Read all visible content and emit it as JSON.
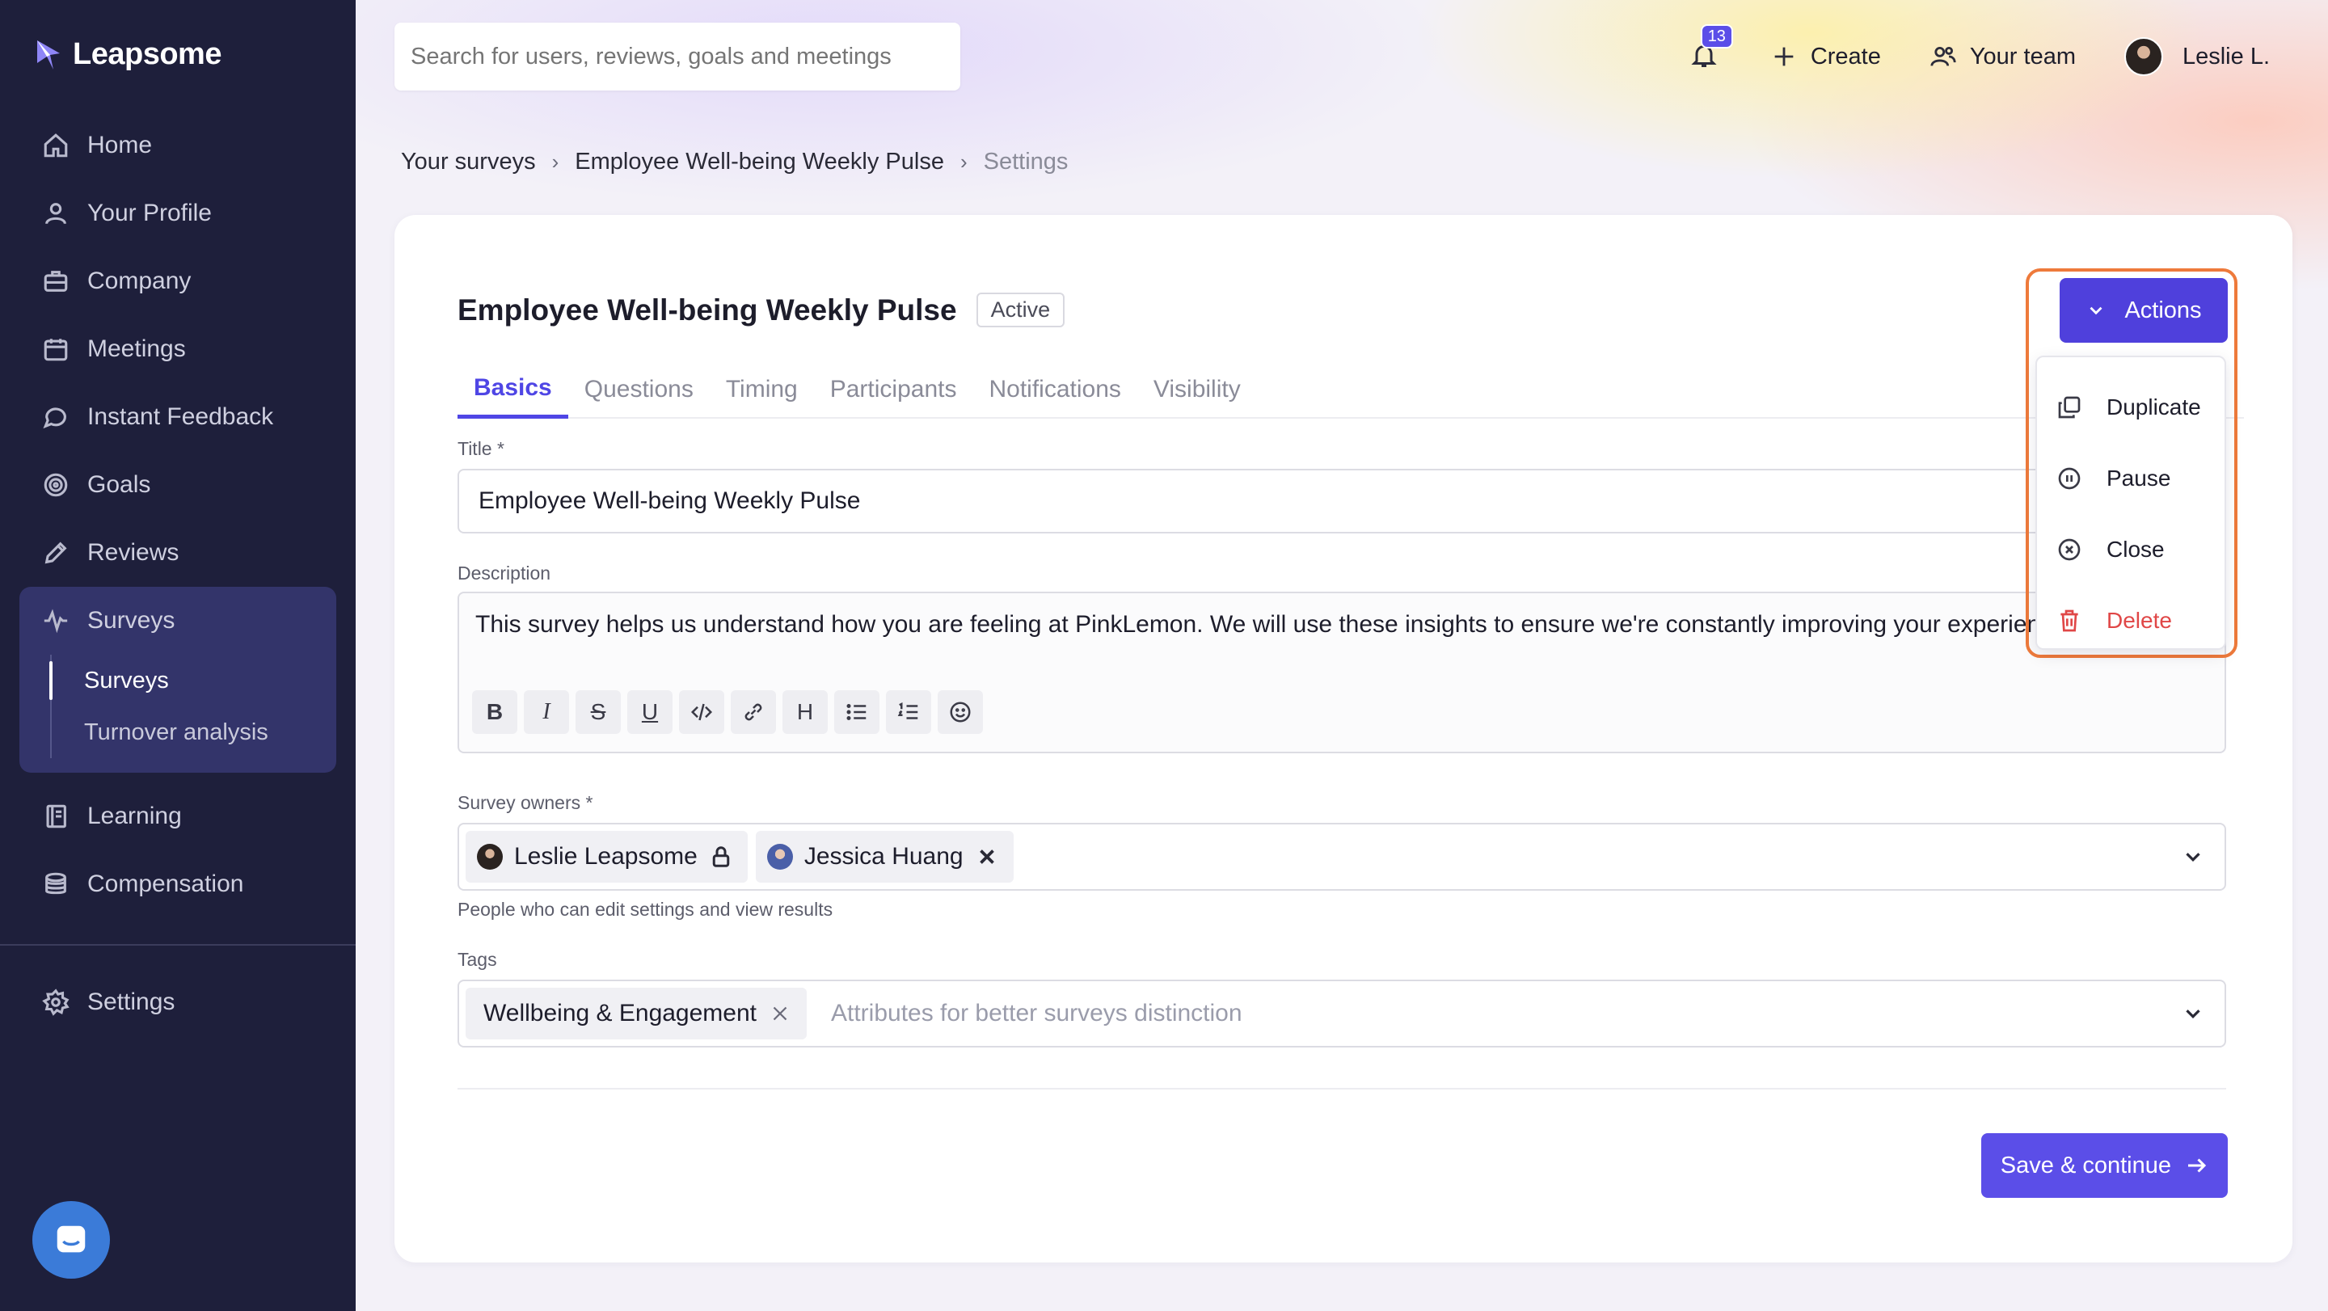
{
  "brand": {
    "name": "Leapsome"
  },
  "sidebar": {
    "items": [
      {
        "label": "Home",
        "icon": "home-icon"
      },
      {
        "label": "Your Profile",
        "icon": "user-icon"
      },
      {
        "label": "Company",
        "icon": "briefcase-icon"
      },
      {
        "label": "Meetings",
        "icon": "calendar-icon"
      },
      {
        "label": "Instant Feedback",
        "icon": "chat-icon"
      },
      {
        "label": "Goals",
        "icon": "target-icon"
      },
      {
        "label": "Reviews",
        "icon": "pencil-icon"
      }
    ],
    "surveys": {
      "label": "Surveys",
      "icon": "pulse-icon",
      "sub_items": [
        {
          "label": "Surveys",
          "active": true
        },
        {
          "label": "Turnover analysis",
          "active": false
        }
      ]
    },
    "items_after": [
      {
        "label": "Learning",
        "icon": "book-icon"
      },
      {
        "label": "Compensation",
        "icon": "coins-icon"
      }
    ],
    "settings": {
      "label": "Settings",
      "icon": "gear-icon"
    }
  },
  "topbar": {
    "search_placeholder": "Search for users, reviews, goals and meetings",
    "notifications_count": "13",
    "create_label": "Create",
    "team_label": "Your team",
    "user_name": "Leslie L."
  },
  "breadcrumb": {
    "root": "Your surveys",
    "survey": "Employee Well-being Weekly Pulse",
    "current": "Settings"
  },
  "card": {
    "title": "Employee Well-being Weekly Pulse",
    "status": "Active",
    "tabs": [
      "Basics",
      "Questions",
      "Timing",
      "Participants",
      "Notifications",
      "Visibility"
    ],
    "active_tab": "Basics",
    "title_label": "Title *",
    "title_value": "Employee Well-being Weekly Pulse",
    "description_label": "Description",
    "description_value": "This survey helps us understand how you are feeling at PinkLemon. We will use these insights to ensure we're constantly improving your experienc",
    "owners_label": "Survey owners *",
    "owners": [
      {
        "name": "Leslie Leapsome",
        "locked": true
      },
      {
        "name": "Jessica Huang",
        "locked": false
      }
    ],
    "owners_help": "People who can edit settings and view results",
    "tags_label": "Tags",
    "tags": [
      "Wellbeing & Engagement"
    ],
    "tags_placeholder": "Attributes for better surveys distinction",
    "save_label": "Save & continue"
  },
  "actions": {
    "button_label": "Actions",
    "menu": [
      {
        "label": "Duplicate",
        "icon": "duplicate-icon"
      },
      {
        "label": "Pause",
        "icon": "pause-icon"
      },
      {
        "label": "Close",
        "icon": "close-circle-icon"
      },
      {
        "label": "Delete",
        "icon": "trash-icon",
        "color": "#e04747"
      }
    ]
  },
  "colors": {
    "sidebar_bg": "#1e1f3b",
    "accent": "#5b4ee8",
    "highlight": "#ee7a3b",
    "danger": "#e04747"
  }
}
